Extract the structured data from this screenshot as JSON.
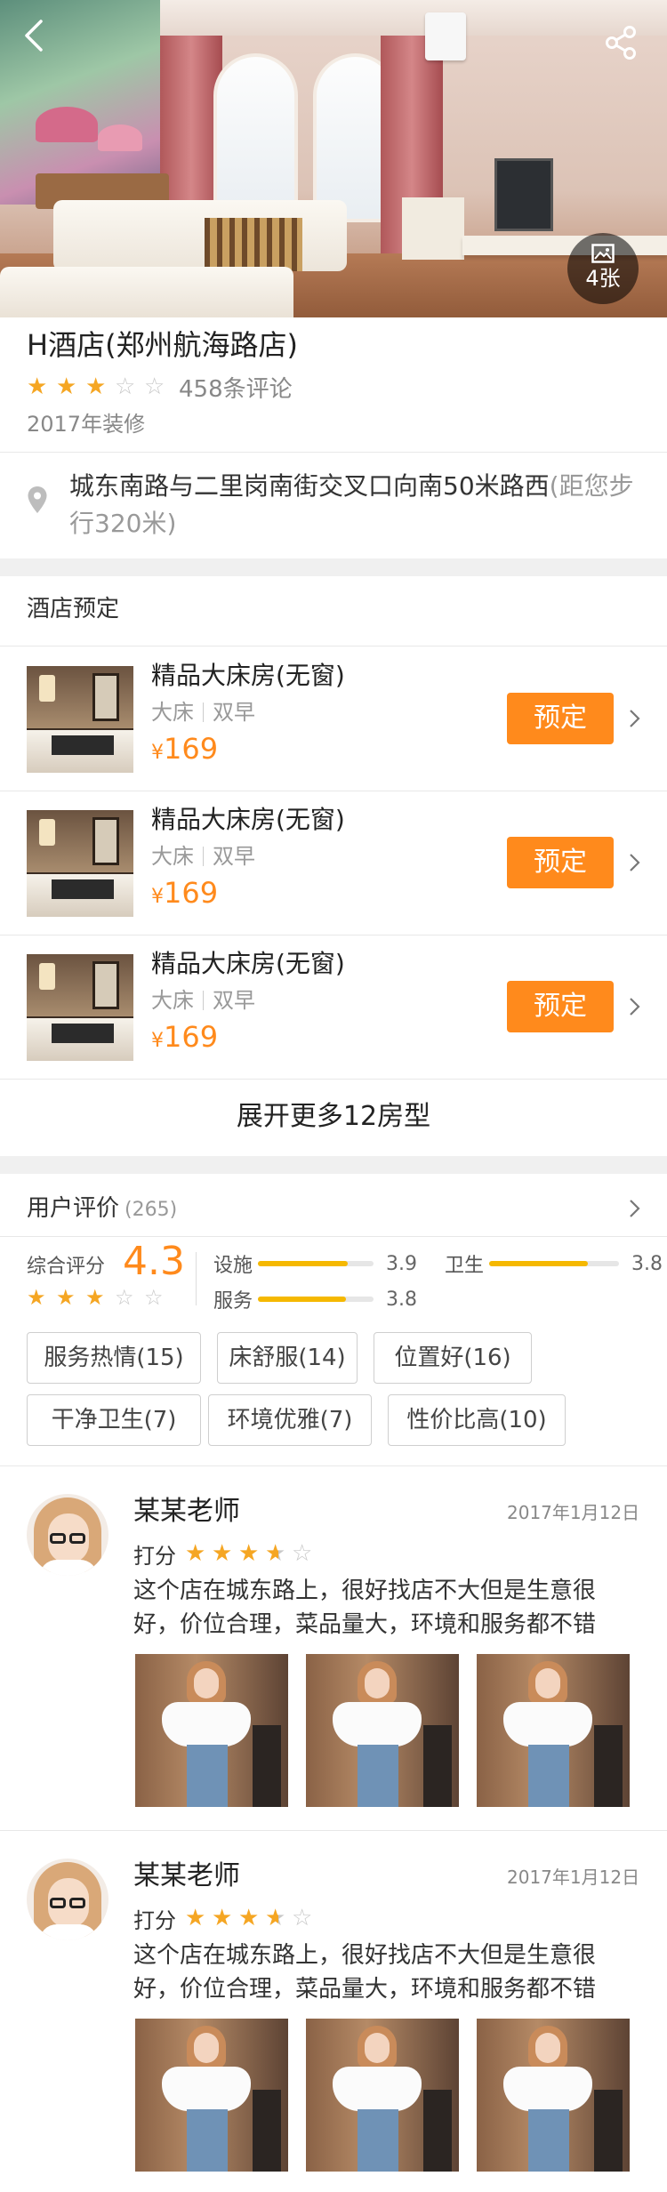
{
  "hero": {
    "photo_count": "4张",
    "back_icon": "back-arrow-icon",
    "share_icon": "share-icon",
    "photo_icon": "picture-icon"
  },
  "hotel": {
    "name": "H酒店(郑州航海路店)",
    "stars": 3,
    "stars_max": 5,
    "review_count": "458条评论",
    "renovated": "2017年装修"
  },
  "address": {
    "icon": "location-pin-icon",
    "text": "城东南路与二里岗南街交叉口向南50米路西",
    "distance": "(距您步行320米)"
  },
  "booking": {
    "title": "酒店预定",
    "rooms": [
      {
        "name": "精品大床房(无窗)",
        "bed": "大床",
        "breakfast": "双早",
        "currency": "¥",
        "price": "169",
        "button": "预定"
      },
      {
        "name": "精品大床房(无窗)",
        "bed": "大床",
        "breakfast": "双早",
        "currency": "¥",
        "price": "169",
        "button": "预定"
      },
      {
        "name": "精品大床房(无窗)",
        "bed": "大床",
        "breakfast": "双早",
        "currency": "¥",
        "price": "169",
        "button": "预定"
      }
    ],
    "expand_label": "展开更多12房型"
  },
  "reviews": {
    "title": "用户评价",
    "count": "(265)",
    "overall_label": "综合评分",
    "overall_score": "4.3",
    "overall_stars": 3,
    "sub_scores": [
      {
        "label": "设施",
        "value": "3.9",
        "fill": 0.78
      },
      {
        "label": "卫生",
        "value": "3.8",
        "fill": 0.76
      },
      {
        "label": "服务",
        "value": "3.8",
        "fill": 0.76
      }
    ],
    "tags": [
      "服务热情(15)",
      "床舒服(14)",
      "位置好(16)",
      "干净卫生(7)",
      "环境优雅(7)",
      "性价比高(10)"
    ],
    "items": [
      {
        "user": "某某老师",
        "date": "2017年1月12日",
        "score_label": "打分",
        "stars": 3.5,
        "text": "这个店在城东路上，很好找店不大但是生意很好，价位合理，菜品量大，环境和服务都不错"
      },
      {
        "user": "某某老师",
        "date": "2017年1月12日",
        "score_label": "打分",
        "stars": 3.5,
        "text": "这个店在城东路上，很好找店不大但是生意很好，价位合理，菜品量大，环境和服务都不错"
      }
    ]
  },
  "colors": {
    "accent": "#ff8a1c",
    "star": "#f5a623",
    "bar": "#f5b800",
    "section_gap": "#f0f0f0"
  }
}
